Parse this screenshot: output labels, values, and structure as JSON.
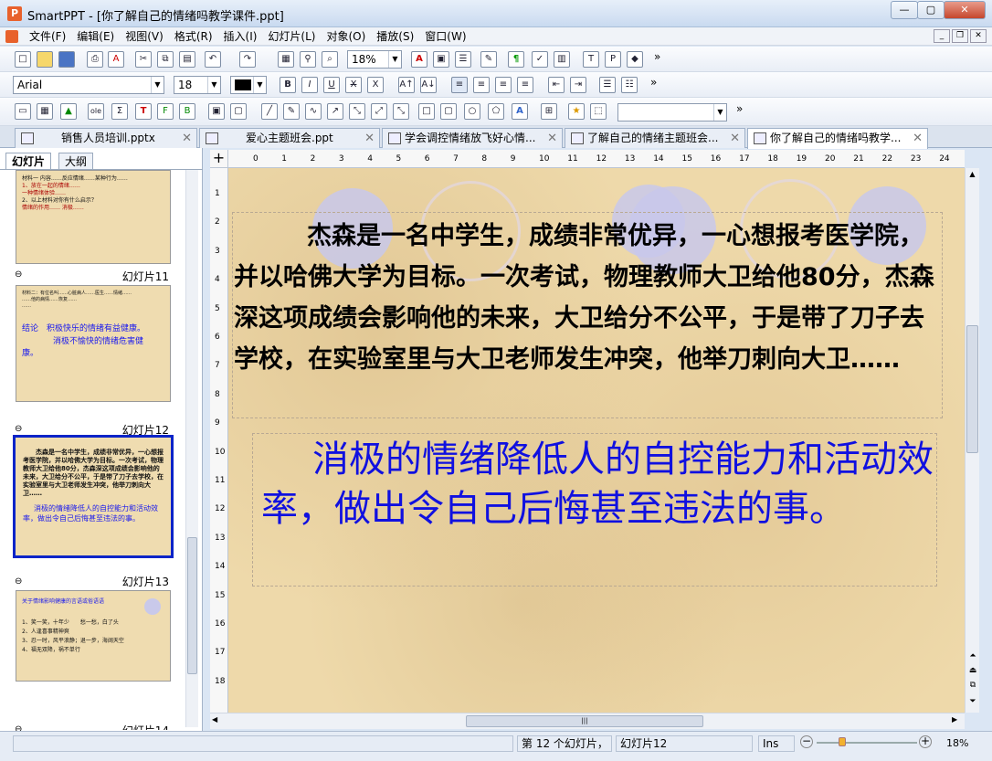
{
  "window": {
    "title": "SmartPPT - [你了解自己的情绪吗教学课件.ppt]",
    "min": "—",
    "max": "▢",
    "close": "✕"
  },
  "menu": [
    "文件(F)",
    "编辑(E)",
    "视图(V)",
    "格式(R)",
    "插入(I)",
    "幻灯片(L)",
    "对象(O)",
    "播放(S)",
    "窗口(W)"
  ],
  "toolbar": {
    "zoom": "18%",
    "font": "Arial",
    "size": "18",
    "more": "»"
  },
  "tabs": [
    {
      "label": "销售人员培训.pptx",
      "close": "✕"
    },
    {
      "label": "爱心主题班会.ppt",
      "close": "✕"
    },
    {
      "label": "学会调控情绪放飞好心情...",
      "close": "✕"
    },
    {
      "label": "了解自己的情绪主题班会...",
      "close": "✕"
    },
    {
      "label": "你了解自己的情绪吗教学...",
      "close": "✕"
    }
  ],
  "panel": {
    "tab_slides": "幻灯片",
    "tab_outline": "大纲"
  },
  "slides": [
    {
      "label": "幻灯片11"
    },
    {
      "label": "幻灯片12"
    },
    {
      "label": "幻灯片13"
    },
    {
      "label": "幻灯片14"
    }
  ],
  "thumb11": {
    "line1": "结论",
    "line2": "积极快乐的情绪有益健康。",
    "line3": "消极不愉快的情绪危害健",
    "line4": "康。"
  },
  "thumb12": {
    "p1": "杰森是一名中学生，成绩非常优异，一心想报考医学院，并以哈佛大学为目标。一次考试，物理教师大卫给他80分，杰森深这项成绩会影响他的未来，大卫给分不公平，于是带了刀子去学校，在实验室里与大卫老师发生冲突，他举刀刺向大卫……",
    "p2": "消极的情绪降低人的自控能力和活动效率，做出令自己后悔甚至违法的事。"
  },
  "thumb13": {
    "title": "关于情绪影响健康的言语或俗语语",
    "items": [
      "1、笑一笑，十年少　　愁一愁，白了头",
      "2、人逢喜事精神爽",
      "3、忍一时，风平浪静；退一步，海阔天空",
      "4、福无双降，祸不单行"
    ]
  },
  "slide": {
    "para1": "杰森是一名中学生，成绩非常优异，一心想报考医学院，并以哈佛大学为目标。一次考试，物理教师大卫给他80分，杰森深这项成绩会影响他的未来，大卫给分不公平，于是带了刀子去学校，在实验室里与大卫老师发生冲突，他举刀刺向大卫……",
    "para2": "消极的情绪降低人的自控能力和活动效率，做出令自己后悔甚至违法的事。"
  },
  "status": {
    "count": "第 12 个幻灯片，",
    "current": "幻灯片12",
    "ins": "Ins",
    "zoom": "18%"
  }
}
